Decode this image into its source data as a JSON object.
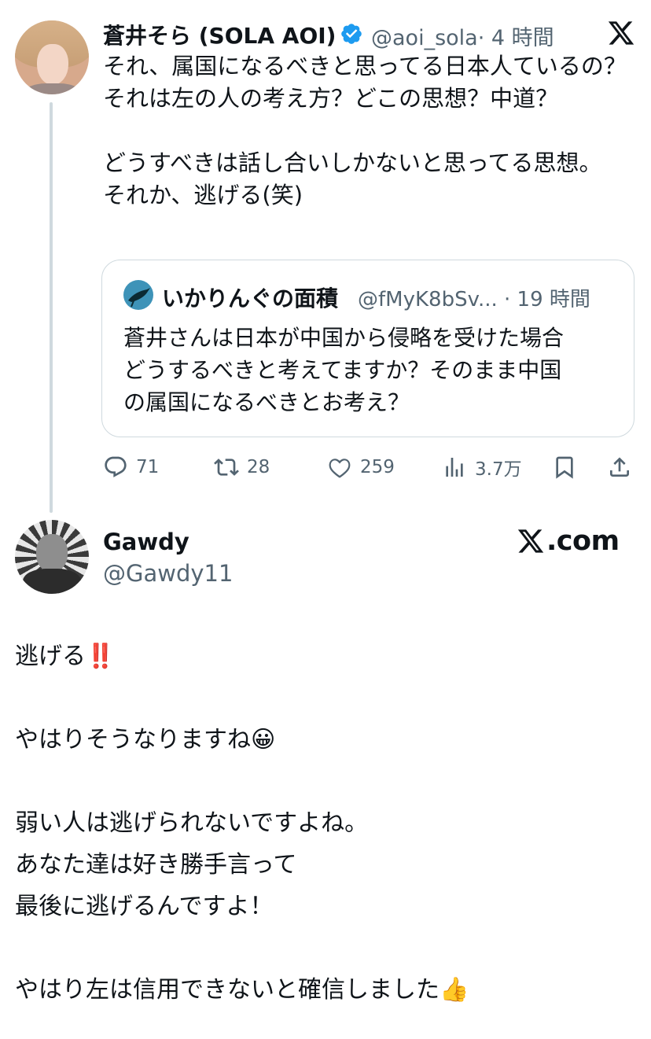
{
  "tweet": {
    "author_name": "蒼井そら (SOLA AOI)",
    "author_handle": "@aoi_sola",
    "time": "· 4 時間",
    "text": "それ、属国になるべきと思ってる日本人ているの？\nそれは左の人の考え方？どこの思想？中道？\n\nどうすべきは話し合いしかないと思ってる思想。\nそれか、逃げる(笑)",
    "quoted": {
      "author_name": "いかりんぐの面積",
      "author_handle": "@fMyK8bSv...",
      "time": "· 19 時間",
      "text": "蒼井さんは日本が中国から侵略を受けた場合\nどうするべきと考えてますか？そのまま中国\nの属国になるべきとお考え？"
    },
    "actions": {
      "replies": "71",
      "retweets": "28",
      "likes": "259",
      "views": "3.7万"
    }
  },
  "reply_card": {
    "display_name": "Gawdy",
    "handle": "@Gawdy11",
    "brand": ".com",
    "text": "逃げる‼️\n\nやはりそうなりますね😀\n\n弱い人は逃げられないですよね。\nあなた達は好き勝手言って\n最後に逃げるんですよ！\n\nやはり左は信用できないと確信しました👍"
  },
  "colors": {
    "text": "#0f1419",
    "secondary": "#536471",
    "border": "#cfd9de",
    "verified": "#1d9bf0"
  },
  "icons": [
    "x-logo-icon",
    "verified-badge-icon",
    "reply-icon",
    "retweet-icon",
    "like-icon",
    "views-icon",
    "bookmark-icon",
    "share-icon"
  ]
}
